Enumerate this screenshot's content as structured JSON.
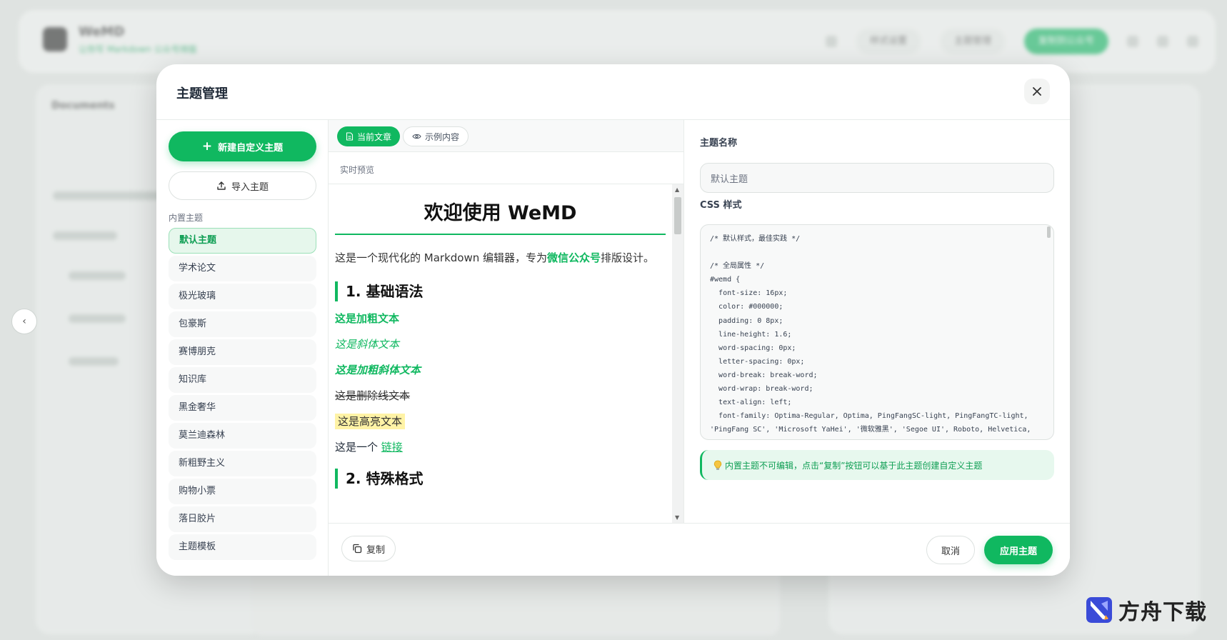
{
  "background": {
    "app_title": "WeMD",
    "app_subtitle": "让你写 Markdown 公众号排版",
    "actions": [
      "样式设置",
      "主题管理",
      "复制到公众号"
    ],
    "sidebar_title": "Documents",
    "collapse_glyph": "‹"
  },
  "modal": {
    "title": "主题管理",
    "close_glyph": "✕"
  },
  "theme_panel": {
    "new_button": "新建自定义主题",
    "import_button": "导入主题",
    "section_label": "内置主题",
    "themes": [
      "默认主题",
      "学术论文",
      "极光玻璃",
      "包豪斯",
      "赛博朋克",
      "知识库",
      "黑金奢华",
      "莫兰迪森林",
      "新粗野主义",
      "购物小票",
      "落日胶片",
      "主题模板"
    ],
    "active_index": 0
  },
  "preview": {
    "tabs": [
      "当前文章",
      "示例内容"
    ],
    "active_tab": 0,
    "label": "实时预览",
    "article": {
      "h1": "欢迎使用 WeMD",
      "intro_before": "这是一个现代化的 Markdown 编辑器，专为",
      "intro_brand": "微信公众号",
      "intro_after": "排版设计。",
      "h2_1": "1. 基础语法",
      "bold": "这是加粗文本",
      "italic": "这是斜体文本",
      "bold_italic": "这是加粗斜体文本",
      "strike": "这是删除线文本",
      "highlight": "这是高亮文本",
      "link_prefix": "这是一个 ",
      "link": "链接",
      "h2_2": "2. 特殊格式"
    }
  },
  "footer": {
    "copy_button": "复制",
    "cancel_button": "取消",
    "apply_button": "应用主题"
  },
  "editor": {
    "name_label": "主题名称",
    "name_value": "默认主题",
    "css_label": "CSS 样式",
    "css_code": "/* 默认样式，最佳实践 */\n\n/* 全局属性 */\n#wemd {\n  font-size: 16px;\n  color: #000000;\n  padding: 0 8px;\n  line-height: 1.6;\n  word-spacing: 0px;\n  letter-spacing: 0px;\n  word-break: break-word;\n  word-wrap: break-word;\n  text-align: left;\n  font-family: Optima-Regular, Optima, PingFangSC-light, PingFangTC-light, 'PingFang SC', 'Microsoft YaHei', '微软雅黑', 'Segoe UI', Roboto, Helvetica, Arial, sans-serif;\n}",
    "notice": "内置主题不可编辑，点击“复制”按钮可以基于此主题创建自定义主题"
  },
  "watermark": {
    "text": "方舟下载"
  },
  "colors": {
    "accent": "#10b860",
    "accent_light": "#e6f7ec",
    "highlight": "#fff3a6"
  }
}
